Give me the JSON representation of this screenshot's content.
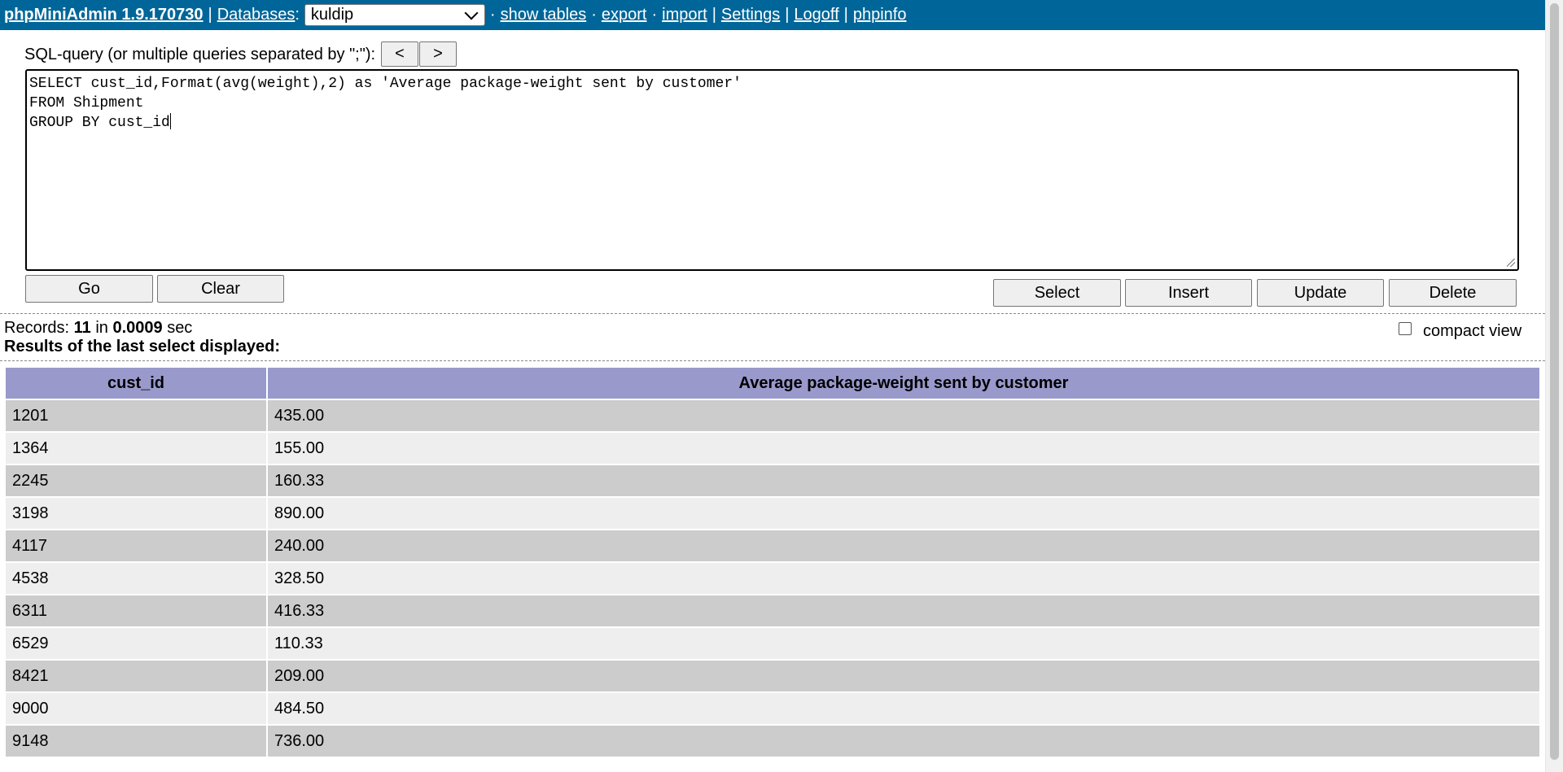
{
  "header": {
    "brand": "phpMiniAdmin 1.9.170730",
    "databases_label": "Databases",
    "selected_db": "kuldip",
    "links": [
      "show tables",
      "export",
      "import",
      "Settings",
      "Logoff",
      "phpinfo"
    ]
  },
  "sql": {
    "label": "SQL-query (or multiple queries separated by \";\"):",
    "prev_label": "<",
    "next_label": ">",
    "query_lines": [
      "SELECT cust_id,Format(avg(weight),2) as 'Average package-weight sent by customer'",
      "FROM Shipment",
      "GROUP BY cust_id"
    ]
  },
  "buttons": {
    "go": "Go",
    "clear": "Clear",
    "select": "Select",
    "insert": "Insert",
    "update": "Update",
    "delete": "Delete"
  },
  "status": {
    "records_label": "Records:",
    "records_count": "11",
    "in_label": "in",
    "time": "0.0009",
    "sec_label": "sec",
    "results_msg": "Results of the last select displayed:",
    "compact_view": "compact view"
  },
  "table": {
    "columns": [
      "cust_id",
      "Average package-weight sent by customer"
    ],
    "rows": [
      [
        "1201",
        "435.00"
      ],
      [
        "1364",
        "155.00"
      ],
      [
        "2245",
        "160.33"
      ],
      [
        "3198",
        "890.00"
      ],
      [
        "4117",
        "240.00"
      ],
      [
        "4538",
        "328.50"
      ],
      [
        "6311",
        "416.33"
      ],
      [
        "6529",
        "110.33"
      ],
      [
        "8421",
        "209.00"
      ],
      [
        "9000",
        "484.50"
      ],
      [
        "9148",
        "736.00"
      ]
    ]
  },
  "colors": {
    "header_bg": "#006699",
    "th_bg": "#9999cc",
    "row_odd": "#cccccc",
    "row_even": "#eeeeee"
  }
}
